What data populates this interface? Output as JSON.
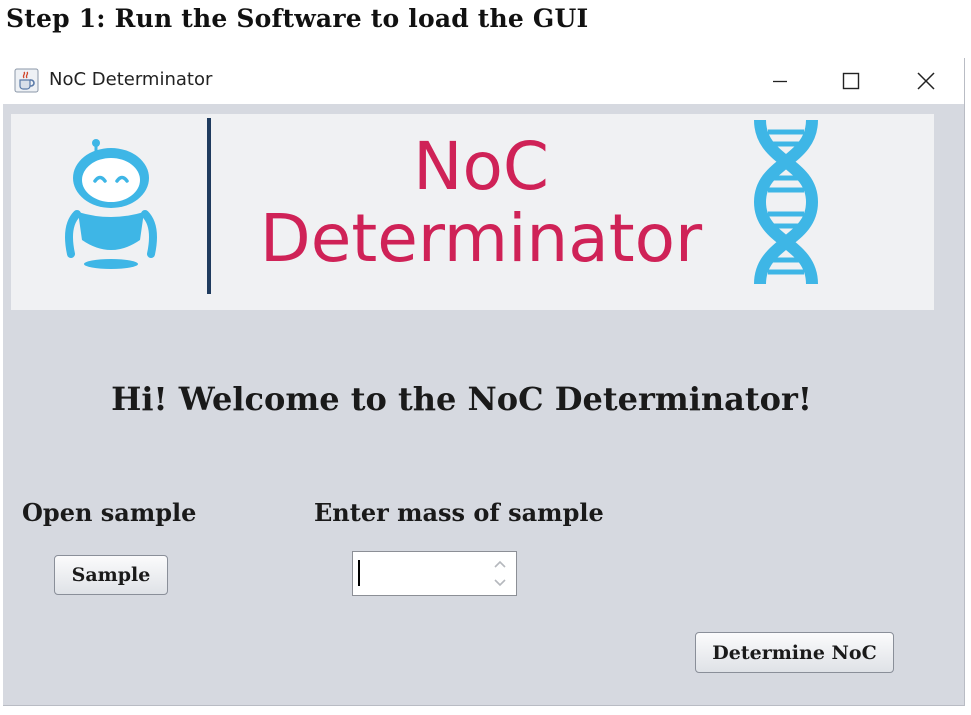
{
  "document": {
    "heading": "Step 1: Run the Software to load the GUI"
  },
  "window": {
    "title": "NoC Determinator",
    "controls": {
      "minimize_icon": "minimize-icon",
      "maximize_icon": "maximize-icon",
      "close_icon": "close-icon"
    }
  },
  "banner": {
    "line1": "NoC",
    "line2": "Determinator",
    "left_icon": "robot-icon",
    "right_icon": "dna-icon",
    "colors": {
      "text": "#cf2257",
      "icons": "#3eb6e6",
      "divider": "#1f3b5e"
    }
  },
  "main": {
    "welcome": "Hi! Welcome to the NoC Determinator!",
    "open_sample_label": "Open sample",
    "sample_button": "Sample",
    "mass_label": "Enter mass of sample",
    "mass_value": "",
    "determine_button": "Determine NoC"
  }
}
